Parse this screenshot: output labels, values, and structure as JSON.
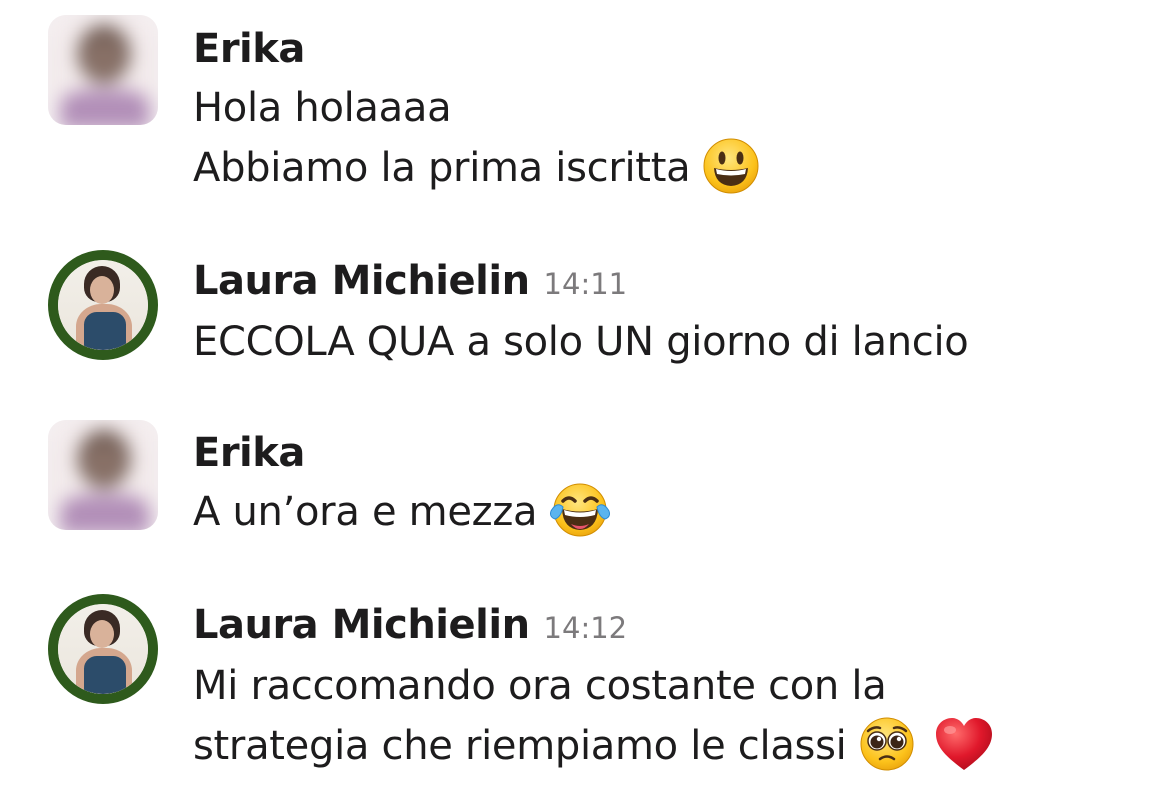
{
  "messages": [
    {
      "sender": "Erika",
      "timestamp": "",
      "avatar": "blurred-avatar",
      "lines": [
        {
          "text": "Hola holaaaa",
          "emoji": ""
        },
        {
          "text": "Abbiamo la prima iscritta",
          "emoji": "grinning-face-icon"
        }
      ]
    },
    {
      "sender": "Laura Michielin",
      "timestamp": "14:11",
      "avatar": "profile-photo-avatar",
      "lines": [
        {
          "text": "ECCOLA QUA a solo UN giorno di lancio",
          "emoji": ""
        }
      ]
    },
    {
      "sender": "Erika",
      "timestamp": "",
      "avatar": "blurred-avatar",
      "lines": [
        {
          "text": "A un’ora e mezza",
          "emoji": "tears-of-joy-icon"
        }
      ]
    },
    {
      "sender": "Laura Michielin",
      "timestamp": "14:12",
      "avatar": "profile-photo-avatar",
      "lines": [
        {
          "text": "Mi raccomando ora costante con la",
          "emoji": ""
        },
        {
          "text": "strategia che riempiamo le classi",
          "emoji": "pleading-face-icon, red-heart-icon"
        }
      ]
    }
  ],
  "colors": {
    "ring": "#2e5a1c",
    "text": "#1d1c1d",
    "timestamp": "#7c7a7c"
  }
}
